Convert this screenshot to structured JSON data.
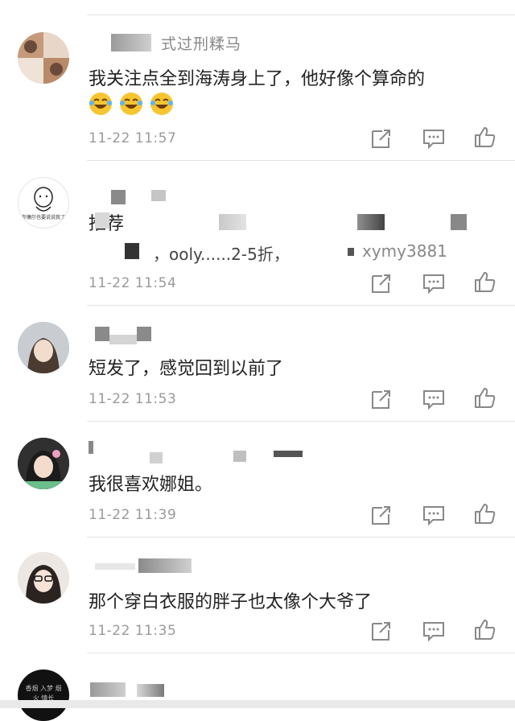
{
  "comments": [
    {
      "name_fragment": "式过刑糅马",
      "text": "我关注点全到海涛身上了，他好像个算命的",
      "time": "11-22 11:57",
      "emojis": [
        "laugh-cry-emoji",
        "laugh-cry-emoji",
        "laugh-cry-emoji"
      ]
    },
    {
      "name_fragment": "",
      "text": "推荐",
      "sub_text": "，ooly......2-5折，",
      "sub_text_2": "xymy3881",
      "avatar_caption": "你偶尔也要说说我了",
      "time": "11-22 11:54"
    },
    {
      "name_fragment": "",
      "text": "短发了，感觉回到以前了",
      "time": "11-22 11:53"
    },
    {
      "name_fragment": "",
      "text": "我很喜欢娜姐。",
      "time": "11-22 11:39"
    },
    {
      "name_fragment": "",
      "text": "那个穿白衣服的胖子也太像个大爷了",
      "time": "11-22 11:35"
    },
    {
      "name_fragment": "",
      "text": "",
      "avatar_caption": "香烟 入梦 烟火 情长",
      "time": ""
    }
  ],
  "icons": {
    "share": "share-icon",
    "reply": "comment-icon",
    "like": "thumbs-up-icon"
  },
  "colors": {
    "time": "#9a9a9a",
    "text": "#222222",
    "separator": "#e3e3e3"
  }
}
